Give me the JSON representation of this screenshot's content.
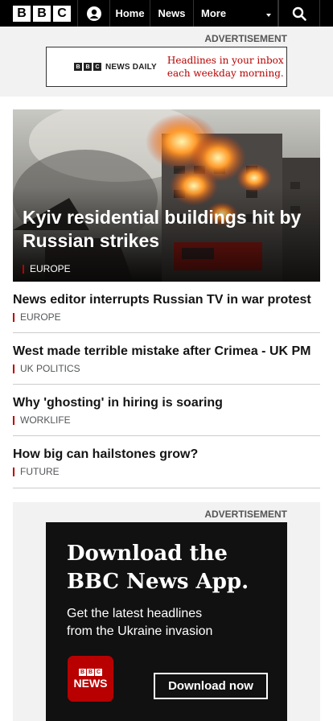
{
  "header": {
    "logo_letters": [
      "B",
      "B",
      "C"
    ],
    "nav": {
      "home": "Home",
      "news": "News",
      "more": "More"
    }
  },
  "ad_top": {
    "label": "ADVERTISEMENT",
    "brand_letters": [
      "B",
      "B",
      "C"
    ],
    "brand_name": "NEWS DAILY",
    "copy_line1": "Headlines in your inbox",
    "copy_line2": "each weekday morning."
  },
  "hero": {
    "title": "Kyiv residential buildings hit by Russian strikes",
    "tag": "EUROPE"
  },
  "stories": [
    {
      "title": "News editor interrupts Russian TV in war protest",
      "tag": "EUROPE"
    },
    {
      "title": "West made terrible mistake after Crimea - UK PM",
      "tag": "UK POLITICS"
    },
    {
      "title": "Why 'ghosting' in hiring is soaring",
      "tag": "WORKLIFE"
    },
    {
      "title": "How big can hailstones grow?",
      "tag": "FUTURE"
    }
  ],
  "ad_bottom": {
    "label": "ADVERTISEMENT",
    "headline_line1": "Download the",
    "headline_line2": "BBC News App.",
    "sub_line1": "Get the latest headlines",
    "sub_line2": "from the Ukraine invasion",
    "logo_letters": [
      "B",
      "B",
      "C"
    ],
    "logo_word": "NEWS",
    "button": "Download now"
  },
  "colors": {
    "accent": "#b80000",
    "header_bg": "#000000"
  }
}
